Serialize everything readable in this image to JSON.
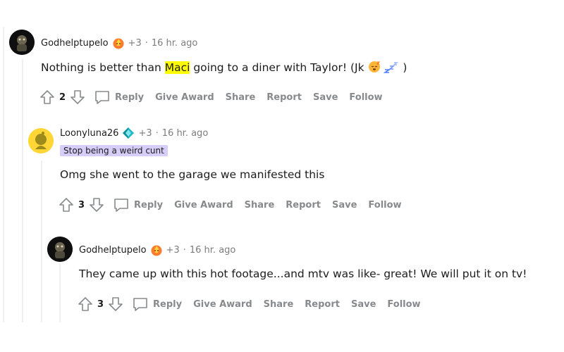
{
  "comments": [
    {
      "username": "Godhelptupelo",
      "award_icon": "fire-award-icon",
      "karma": "+3",
      "separator": "·",
      "time": "16 hr. ago",
      "body_before": "Nothing is better than ",
      "body_highlight": "Maci",
      "body_after": " going to a diner with Taylor! (Jk",
      "body_end": ")",
      "emojis": [
        "sleepy-face-emoji",
        "zzz-emoji"
      ],
      "score": "2",
      "actions": {
        "reply": "Reply",
        "give_award": "Give Award",
        "share": "Share",
        "report": "Report",
        "save": "Save",
        "follow": "Follow"
      }
    },
    {
      "username": "Loonyluna26",
      "award_icon": "diamond-award-icon",
      "karma": "+3",
      "separator": "·",
      "time": "16 hr. ago",
      "flair": "Stop being a weird cunt",
      "body": "Omg she went to the garage we manifested this",
      "score": "3",
      "actions": {
        "reply": "Reply",
        "give_award": "Give Award",
        "share": "Share",
        "report": "Report",
        "save": "Save",
        "follow": "Follow"
      }
    },
    {
      "username": "Godhelptupelo",
      "award_icon": "fire-award-icon",
      "karma": "+3",
      "separator": "·",
      "time": "16 hr. ago",
      "body": "They came up with this hot footage...and mtv was like- great! We will put it on tv!",
      "score": "3",
      "actions": {
        "reply": "Reply",
        "give_award": "Give Award",
        "share": "Share",
        "report": "Report",
        "save": "Save",
        "follow": "Follow"
      }
    }
  ],
  "colors": {
    "meta": "#7c7c7c",
    "action": "#878a8c",
    "flair_bg": "#d6cdf8",
    "highlight": "#ffff00",
    "thread_line": "#edeff1"
  }
}
